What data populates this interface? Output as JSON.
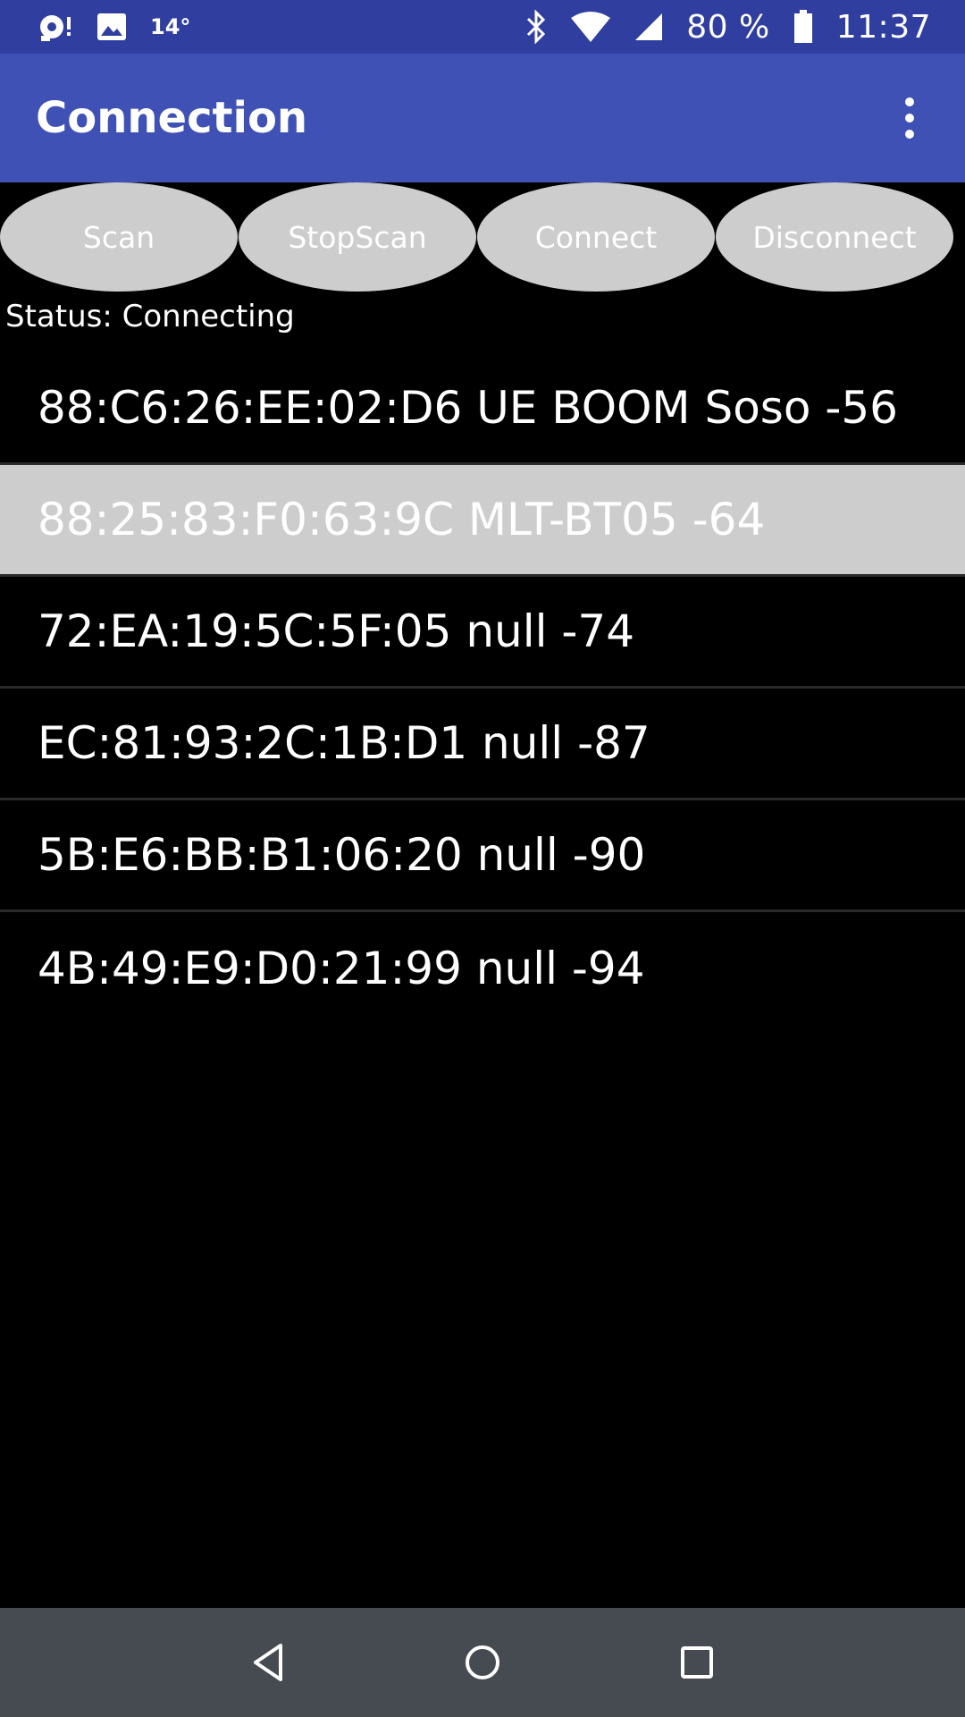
{
  "status_bar": {
    "temperature": "14°",
    "battery_percent": "80 %",
    "time": "11:37",
    "icons": [
      "notification-icon",
      "image-icon",
      "bluetooth-icon",
      "wifi-icon",
      "cell-signal-icon",
      "battery-icon"
    ]
  },
  "app_bar": {
    "title": "Connection",
    "menu_icon": "overflow-menu-icon"
  },
  "buttons": {
    "scan": "Scan",
    "stop_scan": "StopScan",
    "connect": "Connect",
    "disconnect": "Disconnect"
  },
  "status_line": "Status: Connecting",
  "devices": [
    "88:C6:26:EE:02:D6 UE BOOM Soso -56",
    "88:25:83:F0:63:9C MLT-BT05 -64",
    "72:EA:19:5C:5F:05 null -74",
    "EC:81:93:2C:1B:D1 null -87",
    "5B:E6:BB:B1:06:20 null -90",
    "4B:49:E9:D0:21:99 null -94"
  ],
  "selected_device_index": 1,
  "colors": {
    "status_bar": "#303F9F",
    "app_bar": "#3F51B5",
    "button_bg": "#CDCDCD",
    "selected_row": "#CDCDCD",
    "nav_bar": "#454B50"
  },
  "nav": {
    "icons": [
      "back-icon",
      "home-icon",
      "recents-icon"
    ]
  }
}
